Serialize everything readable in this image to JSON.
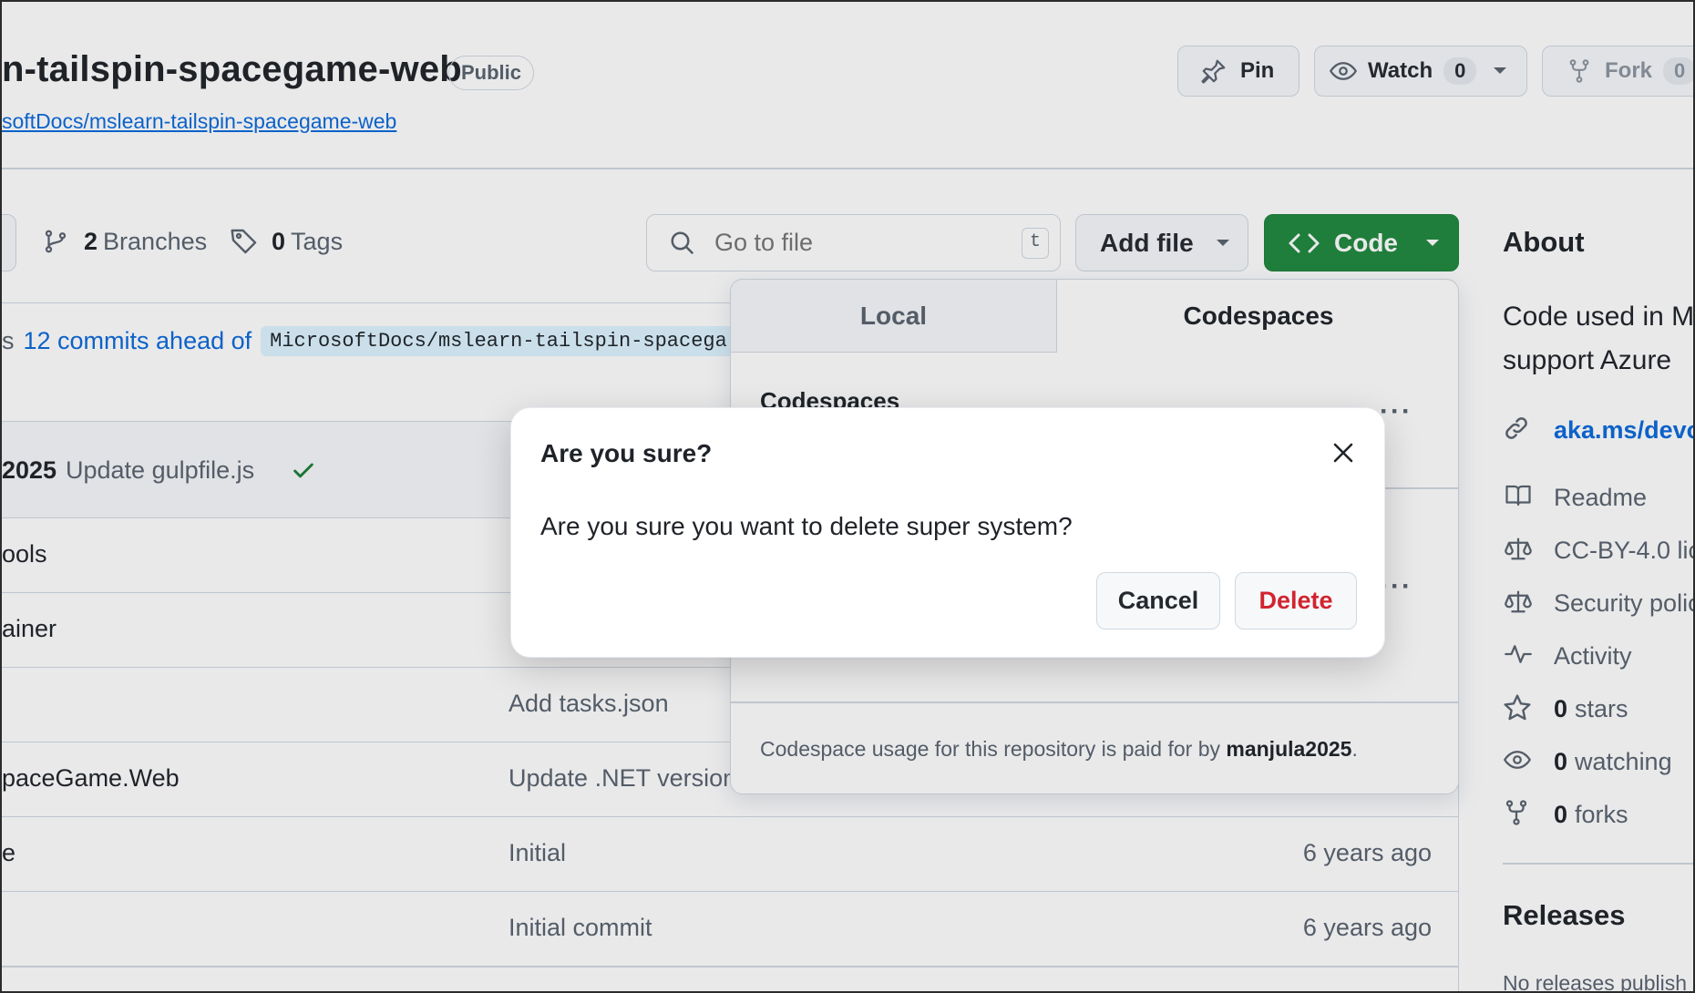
{
  "repo": {
    "name": "n-tailspin-spacegame-web",
    "visibility": "Public",
    "forked_from": "softDocs/mslearn-tailspin-spacegame-web"
  },
  "header_actions": {
    "pin_label": "Pin",
    "watch_label": "Watch",
    "watch_count": "0",
    "fork_label": "Fork",
    "fork_count": "0"
  },
  "toolbar": {
    "branches_count": "2",
    "branches_label": "Branches",
    "tags_count": "0",
    "tags_label": "Tags",
    "search_placeholder": "Go to file",
    "search_shortcut": "t",
    "add_file_label": "Add file",
    "code_label": "Code"
  },
  "ahead": {
    "prefix": "s",
    "link_text": "12 commits ahead of",
    "upstream": "MicrosoftDocs/mslearn-tailspin-spacega"
  },
  "latest_commit": {
    "author_fragment": "2025",
    "message": "Update gulpfile.js"
  },
  "files": [
    {
      "name": "ools",
      "message": "",
      "age": ""
    },
    {
      "name": "ainer",
      "message": "",
      "age": ""
    },
    {
      "name": "",
      "message": "Add tasks.json",
      "age": ""
    },
    {
      "name": "paceGame.Web",
      "message": "Update .NET version",
      "age": ""
    },
    {
      "name": "e",
      "message": "Initial",
      "age": "6 years ago"
    },
    {
      "name": "",
      "message": "Initial commit",
      "age": "6 years ago"
    }
  ],
  "code_panel": {
    "tab_local": "Local",
    "tab_codespaces": "Codespaces",
    "section_title": "Codespaces",
    "footer_prefix": "Codespace usage for this repository is paid for by",
    "footer_user": "manjula2025",
    "footer_suffix": "."
  },
  "dialog": {
    "title": "Are you sure?",
    "body": "Are you sure you want to delete super system?",
    "cancel_label": "Cancel",
    "delete_label": "Delete"
  },
  "sidebar": {
    "about_title": "About",
    "description_line1": "Code used in M",
    "description_line2": "support Azure",
    "website": "aka.ms/devo",
    "items": {
      "readme": "Readme",
      "license": "CC-BY-4.0 lic",
      "security": "Security polic",
      "activity": "Activity",
      "stars_count": "0",
      "stars_label": "stars",
      "watching_count": "0",
      "watching_label": "watching",
      "forks_count": "0",
      "forks_label": "forks"
    },
    "releases_title": "Releases",
    "releases_text": "No releases publish"
  },
  "colors": {
    "accent": "#0969da",
    "primary_button": "#1f883d",
    "danger": "#d1242f",
    "success": "#1a7f37"
  },
  "icons": [
    "pin-icon",
    "eye-icon",
    "chevron-down-icon",
    "fork-icon",
    "branch-icon",
    "tag-icon",
    "search-icon",
    "code-icon",
    "check-icon",
    "close-icon",
    "kebab-icon",
    "link-icon",
    "book-icon",
    "scale-icon",
    "pulse-icon",
    "star-icon"
  ]
}
